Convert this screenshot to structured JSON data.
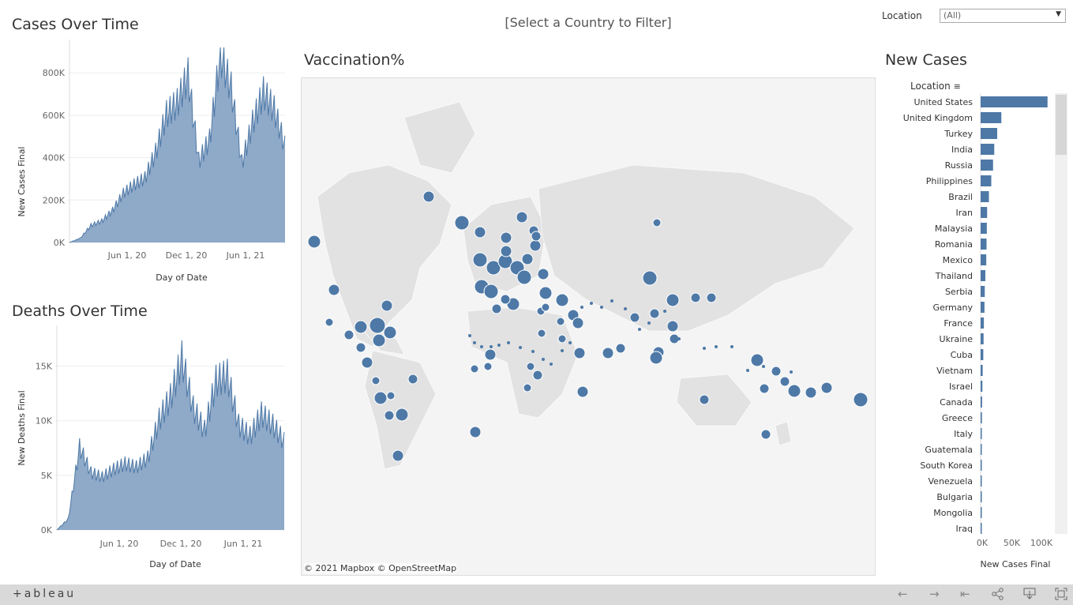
{
  "filter_hint": "[Select a Country to Filter]",
  "location_filter": {
    "label": "Location",
    "value": "(All)"
  },
  "cases_chart": {
    "title": "Cases Over Time",
    "ylabel": "New Cases Final",
    "xlabel": "Day of Date",
    "yticks": [
      "800K",
      "600K",
      "400K",
      "200K",
      "0K"
    ],
    "xticks": [
      "Jun 1, 20",
      "Dec 1, 20",
      "Jun 1, 21"
    ]
  },
  "deaths_chart": {
    "title": "Deaths Over Time",
    "ylabel": "New Deaths Final",
    "xlabel": "Day of Date",
    "yticks": [
      "15K",
      "10K",
      "5K",
      "0K"
    ],
    "xticks": [
      "Jun 1, 20",
      "Dec 1, 20",
      "Jun 1, 21"
    ]
  },
  "map": {
    "title": "Vaccination%",
    "attribution": "© 2021 Mapbox  © OpenStreetMap"
  },
  "new_cases": {
    "title": "New Cases",
    "column_header": "Location",
    "xlabel": "New Cases Final",
    "xticks": [
      "0K",
      "50K",
      "100K"
    ]
  },
  "chart_data": [
    {
      "type": "area",
      "title": "Cases Over Time",
      "xlabel": "Day of Date",
      "ylabel": "New Cases Final",
      "x": [
        "2020-01",
        "2020-03",
        "2020-04",
        "2020-05",
        "2020-06",
        "2020-07",
        "2020-08",
        "2020-09",
        "2020-10",
        "2020-11",
        "2020-12",
        "2021-01",
        "2021-02",
        "2021-03",
        "2021-04",
        "2021-05",
        "2021-06",
        "2021-07",
        "2021-08",
        "2021-09",
        "2021-10"
      ],
      "values": [
        0,
        20000,
        80000,
        100000,
        150000,
        230000,
        270000,
        300000,
        420000,
        600000,
        650000,
        780000,
        380000,
        480000,
        880000,
        720000,
        370000,
        560000,
        700000,
        620000,
        450000
      ],
      "ylim": [
        0,
        920000
      ]
    },
    {
      "type": "area",
      "title": "Deaths Over Time",
      "xlabel": "Day of Date",
      "ylabel": "New Deaths Final",
      "x": [
        "2020-01",
        "2020-03",
        "2020-04",
        "2020-05",
        "2020-06",
        "2020-07",
        "2020-08",
        "2020-09",
        "2020-10",
        "2020-11",
        "2020-12",
        "2021-01",
        "2021-02",
        "2021-03",
        "2021-04",
        "2021-05",
        "2021-06",
        "2021-07",
        "2021-08",
        "2021-09",
        "2021-10"
      ],
      "values": [
        0,
        1000,
        7500,
        5200,
        4800,
        5500,
        6000,
        5700,
        6500,
        10000,
        12000,
        15500,
        11000,
        9000,
        13500,
        14000,
        9500,
        8500,
        10500,
        9500,
        8000
      ],
      "ylim": [
        0,
        18000
      ]
    },
    {
      "type": "bar",
      "title": "New Cases",
      "xlabel": "New Cases Final",
      "categories": [
        "United States",
        "United Kingdom",
        "Turkey",
        "India",
        "Russia",
        "Philippines",
        "Brazil",
        "Iran",
        "Malaysia",
        "Romania",
        "Mexico",
        "Thailand",
        "Serbia",
        "Germany",
        "France",
        "Ukraine",
        "Cuba",
        "Vietnam",
        "Israel",
        "Canada",
        "Greece",
        "Italy",
        "Guatemala",
        "South Korea",
        "Venezuela",
        "Bulgaria",
        "Mongolia",
        "Iraq"
      ],
      "values": [
        113000,
        35000,
        28000,
        23000,
        21000,
        18000,
        14000,
        11000,
        10500,
        10000,
        9500,
        8000,
        7000,
        6500,
        5500,
        5000,
        4500,
        3500,
        3000,
        2500,
        2200,
        2000,
        1800,
        1700,
        1500,
        1400,
        1300,
        1200
      ],
      "xlim": [
        0,
        120000
      ]
    }
  ],
  "toolbar": {
    "logo": "+ableau",
    "undo_icon": "←",
    "redo_icon": "→",
    "revert_icon": "⇤",
    "share_icon": "share",
    "download_icon": "download",
    "fullscreen_icon": "fullscreen"
  },
  "colors": {
    "series": "#4e79a7",
    "area_fill": "#8fa9c8"
  }
}
